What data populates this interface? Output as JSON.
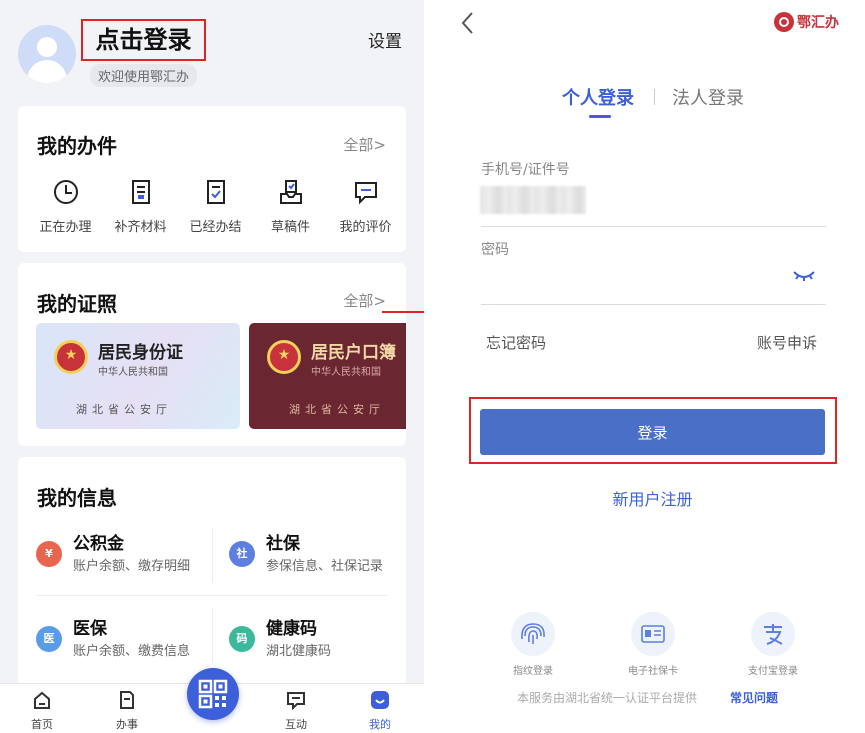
{
  "left": {
    "profile": {
      "login_prompt": "点击登录",
      "welcome": "欢迎使用鄂汇办",
      "settings": "设置"
    },
    "tasks": {
      "title": "我的办件",
      "more": "全部>",
      "items": [
        {
          "label": "正在办理",
          "icon": "clock-icon"
        },
        {
          "label": "补齐材料",
          "icon": "document-icon"
        },
        {
          "label": "已经办结",
          "icon": "document-check-icon"
        },
        {
          "label": "草稿件",
          "icon": "draft-tray-icon"
        },
        {
          "label": "我的评价",
          "icon": "comment-icon"
        }
      ]
    },
    "certs": {
      "title": "我的证照",
      "more": "全部>",
      "items": [
        {
          "name": "居民身份证",
          "sub": "中华人民共和国",
          "issuer": "湖北省公安厅"
        },
        {
          "name": "居民户口簿",
          "sub": "中华人民共和国",
          "issuer": "湖北省公安厅"
        }
      ]
    },
    "info": {
      "title": "我的信息",
      "items": [
        {
          "name": "公积金",
          "desc": "账户余额、缴存明细",
          "icon": "house-fund-icon",
          "icon_text": "¥",
          "color": "#e8664f"
        },
        {
          "name": "社保",
          "desc": "参保信息、社保记录",
          "icon": "social-security-icon",
          "icon_text": "社",
          "color": "#5d7fe0"
        },
        {
          "name": "医保",
          "desc": "账户余额、缴费信息",
          "icon": "medical-insurance-icon",
          "icon_text": "医",
          "color": "#5b9ce8"
        },
        {
          "name": "健康码",
          "desc": "湖北健康码",
          "icon": "health-code-icon",
          "icon_text": "码",
          "color": "#3cb99a"
        }
      ]
    },
    "nav": {
      "home": "首页",
      "tasks": "办事",
      "interact": "互动",
      "mine": "我的"
    }
  },
  "right": {
    "brand": "鄂汇办",
    "tabs": {
      "personal": "个人登录",
      "legal": "法人登录"
    },
    "phone_label": "手机号/证件号",
    "password_label": "密码",
    "forgot": "忘记密码",
    "appeal": "账号申诉",
    "login_button": "登录",
    "register": "新用户注册",
    "alt_logins": [
      {
        "label": "指纹登录",
        "icon": "fingerprint-icon"
      },
      {
        "label": "电子社保卡",
        "icon": "social-security-card-icon"
      },
      {
        "label": "支付宝登录",
        "icon": "alipay-icon"
      }
    ],
    "footer": "本服务由湖北省统一认证平台提供",
    "faq": "常见问题"
  },
  "colors": {
    "accent": "#3d5fd9",
    "button": "#4a6fc7",
    "highlight_frame": "#e02424"
  }
}
